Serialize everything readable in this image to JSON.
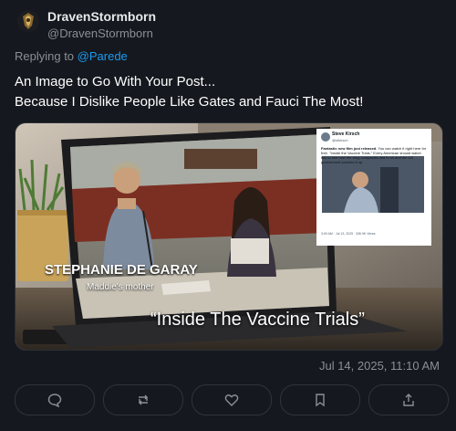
{
  "author": {
    "display_name": "DravenStormborn",
    "handle": "@DravenStormborn"
  },
  "reply": {
    "prefix": "Replying to ",
    "target": "@Parede"
  },
  "post": {
    "line1": "An Image to Go With Your Post...",
    "line2": "Because I Dislike People Like Gates and Fauci The Most!"
  },
  "media": {
    "overlay_name": "STEPHANIE DE GARAY",
    "overlay_subtitle": "Maddie's mother",
    "caption": "“Inside The Vaccine Trials”",
    "embedded_post": {
      "author": "Steve Kirsch",
      "handle": "@stkirsch",
      "text_bold": "Fantastic new film just released.",
      "text": " You can watch it right here for free. \"Inside the Vaccine Trials.\" Every American should watch this to see how the drug companies lied to us and the US government covered it up.",
      "meta": "3:09 AM · Jul 13, 2025 · 336.9K Views"
    }
  },
  "timestamp": "Jul 14, 2025, 11:10 AM",
  "actions": [
    "reply-icon",
    "repost-icon",
    "like-icon",
    "bookmark-icon",
    "share-icon"
  ]
}
